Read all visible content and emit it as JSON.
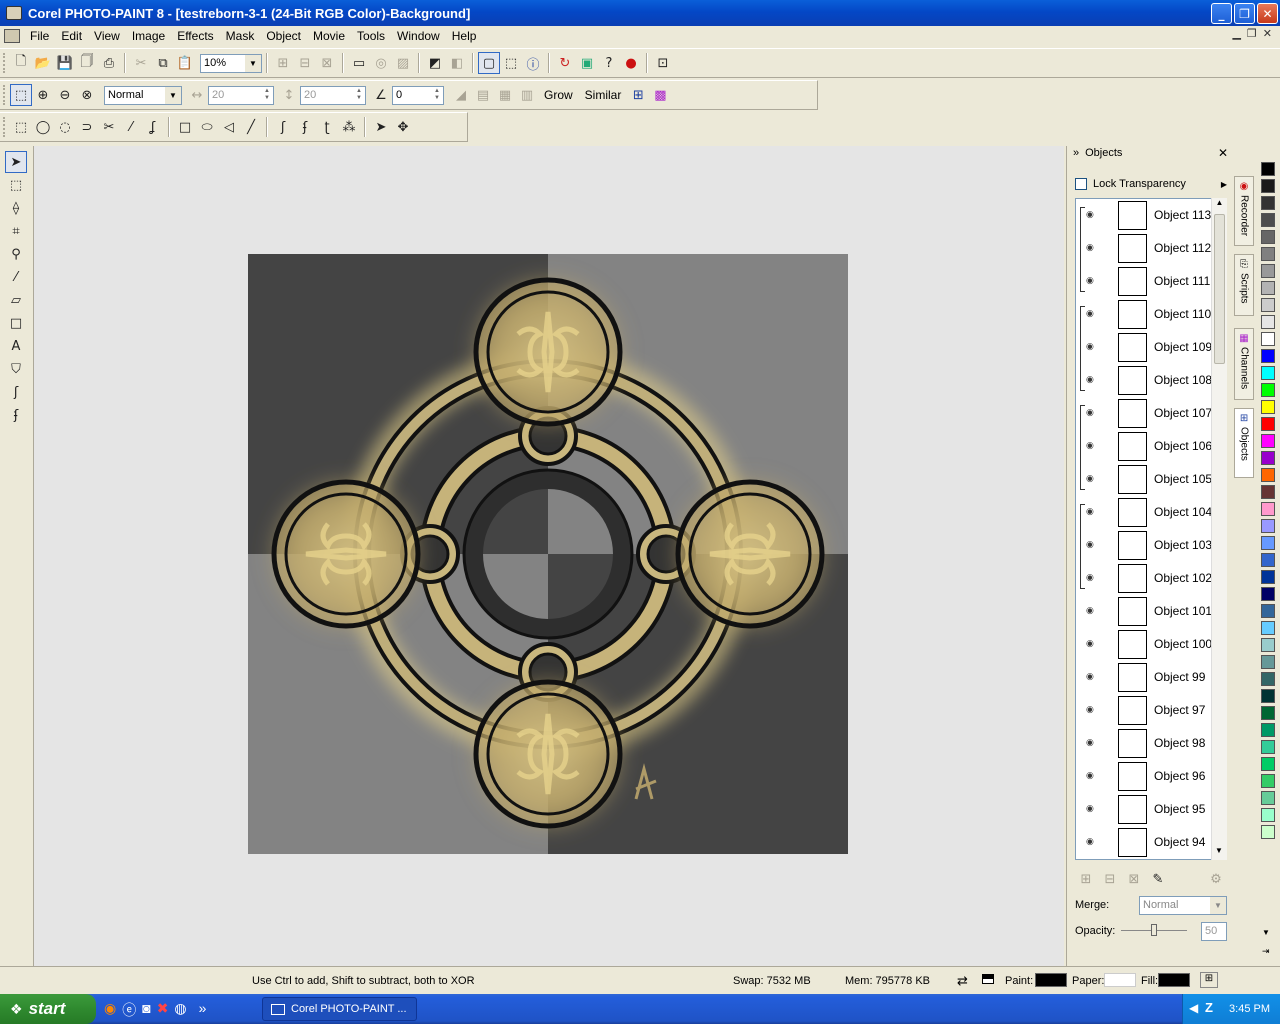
{
  "window": {
    "title": "Corel PHOTO-PAINT 8 - [testreborn-3-1  (24-Bit RGB Color)-Background]",
    "minimize": "_",
    "maximize": "❐",
    "close": "✕"
  },
  "menu": [
    "File",
    "Edit",
    "View",
    "Image",
    "Effects",
    "Mask",
    "Object",
    "Movie",
    "Tools",
    "Window",
    "Help"
  ],
  "toolbar1": {
    "zoom": "10%"
  },
  "toolbar2": {
    "mode": "Normal",
    "width": "20",
    "height": "20",
    "angle": "0",
    "grow": "Grow",
    "similar": "Similar"
  },
  "docker": {
    "title": "Objects",
    "lock_transparency": "Lock Transparency",
    "objects": [
      "Object 113",
      "Object 112",
      "Object 111",
      "Object 110",
      "Object 109",
      "Object 108",
      "Object 107",
      "Object 106",
      "Object 105",
      "Object 104",
      "Object 103",
      "Object 102",
      "Object 101",
      "Object 100",
      "Object 99",
      "Object 97",
      "Object 98",
      "Object 96",
      "Object 95",
      "Object 94"
    ],
    "merge_label": "Merge:",
    "merge_value": "Normal",
    "opacity_label": "Opacity:",
    "opacity_value": "50"
  },
  "sidetabs": [
    "Recorder",
    "Scripts",
    "Channels",
    "Objects"
  ],
  "palette": [
    "#000000",
    "#1a1a1a",
    "#333333",
    "#4d4d4d",
    "#666666",
    "#808080",
    "#999999",
    "#b3b3b3",
    "#cccccc",
    "#e6e6e6",
    "#ffffff",
    "#0000ff",
    "#00ffff",
    "#00ff00",
    "#ffff00",
    "#ff0000",
    "#ff00ff",
    "#9900cc",
    "#ff6600",
    "#663333",
    "#ff99cc",
    "#9999ff",
    "#6699ff",
    "#3366cc",
    "#003399",
    "#000066",
    "#336699",
    "#66ccff",
    "#99cccc",
    "#669999",
    "#336666",
    "#003333",
    "#006633",
    "#009966",
    "#33cc99",
    "#00cc66",
    "#33cc66",
    "#66cc99",
    "#99ffcc",
    "#ccffcc"
  ],
  "status": {
    "hint": "Use Ctrl to add, Shift to subtract, both to XOR",
    "swap": "Swap: 7532 MB",
    "mem": "Mem: 795778 KB",
    "paint": "Paint:",
    "paper": "Paper:",
    "fill": "Fill:",
    "paint_color": "#000000",
    "paper_color": "#ffffff",
    "fill_color": "#000000"
  },
  "taskbar": {
    "start": "start",
    "task": "Corel PHOTO-PAINT ...",
    "clock": "3:45 PM"
  }
}
